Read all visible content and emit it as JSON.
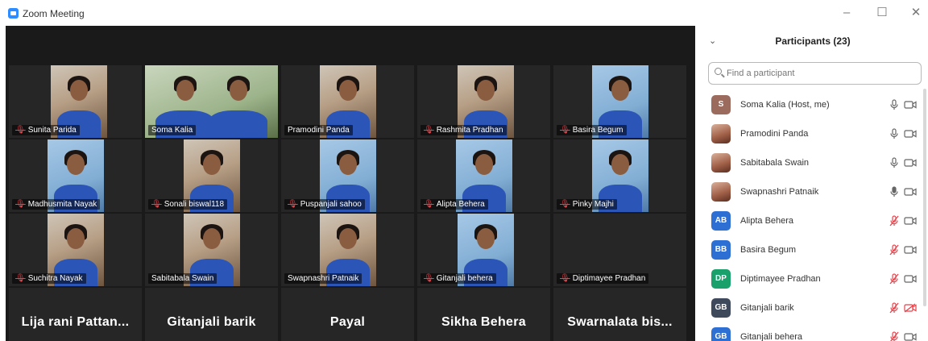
{
  "window": {
    "title": "Zoom Meeting",
    "controls": {
      "minimize": "–",
      "maximize": "☐",
      "close": "✕"
    },
    "accent_color": "#2d8cff"
  },
  "gallery": {
    "tiles": [
      {
        "name": "Sunita Parida",
        "muted": true,
        "video": true
      },
      {
        "name": "Soma Kalia",
        "muted": false,
        "video": true,
        "active_speaker": true
      },
      {
        "name": "Pramodini Panda",
        "muted": false,
        "video": true
      },
      {
        "name": "Rashmita Pradhan",
        "muted": true,
        "video": true
      },
      {
        "name": "Basira Begum",
        "muted": true,
        "video": true
      },
      {
        "name": "Madhusmita Nayak",
        "muted": true,
        "video": true
      },
      {
        "name": "Sonali biswal118",
        "muted": true,
        "video": true
      },
      {
        "name": "Puspanjali sahoo",
        "muted": true,
        "video": true
      },
      {
        "name": "Alipta Behera",
        "muted": true,
        "video": true
      },
      {
        "name": "Pinky Majhi",
        "muted": true,
        "video": true
      },
      {
        "name": "Suchitra Nayak",
        "muted": true,
        "video": true
      },
      {
        "name": "Sabitabala Swain",
        "muted": false,
        "video": true
      },
      {
        "name": "Swapnashri Patnaik",
        "muted": false,
        "video": true
      },
      {
        "name": "Gitanjali behera",
        "muted": true,
        "video": true
      },
      {
        "name": "Diptimayee Pradhan",
        "muted": true,
        "video": false
      },
      {
        "name": "Lija rani Pattan...",
        "muted": false,
        "video": false
      },
      {
        "name": "Gitanjali barik",
        "muted": false,
        "video": false
      },
      {
        "name": "Payal",
        "muted": false,
        "video": false
      },
      {
        "name": "Sikha Behera",
        "muted": false,
        "video": false
      },
      {
        "name": "Swarnalata bis...",
        "muted": false,
        "video": false
      }
    ]
  },
  "participants_panel": {
    "title": "Participants (23)",
    "collapse_icon": "chevron-down-icon",
    "search_placeholder": "Find a participant",
    "items": [
      {
        "name": "Soma Kalia (Host, me)",
        "initials": "S",
        "avatar_color": "#9b6b5e",
        "photo": false,
        "mic": "on",
        "cam": "on"
      },
      {
        "name": "Pramodini Panda",
        "initials": "",
        "avatar_color": "#a3624a",
        "photo": true,
        "mic": "on",
        "cam": "on"
      },
      {
        "name": "Sabitabala Swain",
        "initials": "",
        "avatar_color": "#a3624a",
        "photo": true,
        "mic": "on",
        "cam": "on"
      },
      {
        "name": "Swapnashri Patnaik",
        "initials": "",
        "avatar_color": "#a3624a",
        "photo": true,
        "mic": "active",
        "cam": "on"
      },
      {
        "name": "Alipta Behera",
        "initials": "AB",
        "avatar_color": "#2d6fd2",
        "photo": false,
        "mic": "muted",
        "cam": "on"
      },
      {
        "name": "Basira Begum",
        "initials": "BB",
        "avatar_color": "#2d6fd2",
        "photo": false,
        "mic": "muted",
        "cam": "on"
      },
      {
        "name": "Diptimayee Pradhan",
        "initials": "DP",
        "avatar_color": "#19a06b",
        "photo": false,
        "mic": "muted",
        "cam": "on"
      },
      {
        "name": "Gitanjali barik",
        "initials": "GB",
        "avatar_color": "#3e4a5c",
        "photo": false,
        "mic": "muted",
        "cam": "off"
      },
      {
        "name": "Gitanjali behera",
        "initials": "GB",
        "avatar_color": "#2d6fd2",
        "photo": false,
        "mic": "muted",
        "cam": "on"
      }
    ]
  },
  "colors": {
    "muted_red": "#e8424a",
    "active_speaker": "#c5e53a",
    "gallery_bg": "#1a1a1a"
  }
}
